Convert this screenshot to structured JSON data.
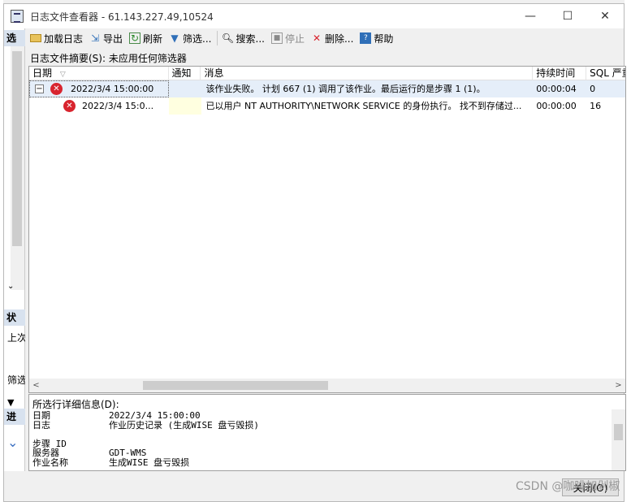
{
  "window": {
    "title": "日志文件查看器 - 61.143.227.49,10524",
    "min_glyph": "—",
    "max_glyph": "☐",
    "close_glyph": "✕"
  },
  "left_pane": {
    "head1": "选",
    "head2": "状",
    "text1": "上次",
    "text2": "筛选",
    "head3": "进"
  },
  "toolbar": {
    "load_log": "加载日志",
    "export": "导出",
    "refresh": "刷新",
    "filter": "筛选...",
    "search": "搜索...",
    "stop": "停止",
    "delete": "删除...",
    "help": "帮助"
  },
  "summary": "日志文件摘要(S): 未应用任何筛选器",
  "grid": {
    "columns": [
      "日期",
      "通知",
      "消息",
      "持续时间",
      "SQL 严重"
    ],
    "rows": [
      {
        "date": "2022/3/4 15:00:00",
        "notify": "",
        "message": "该作业失败。  计划 667 (1) 调用了该作业。最后运行的是步骤 1 (1)。",
        "duration": "00:00:04",
        "severity": "0"
      },
      {
        "date": "2022/3/4 15:0...",
        "notify": "",
        "message": "已以用户 NT AUTHORITY\\NETWORK SERVICE 的身份执行。 找不到存储过...",
        "duration": "00:00:00",
        "severity": "16"
      }
    ]
  },
  "details": {
    "label": "所选行详细信息(D):",
    "lines": [
      {
        "k": "日期",
        "v": "2022/3/4 15:00:00"
      },
      {
        "k": "日志",
        "v": "作业历史记录 (生成WISE 盘亏毁损)"
      },
      {
        "k": "",
        "v": ""
      },
      {
        "k": "步骤 ID",
        "v": ""
      },
      {
        "k": "服务器",
        "v": "GDT-WMS"
      },
      {
        "k": "作业名称",
        "v": "    生成WISE 盘亏毁损"
      }
    ]
  },
  "close_label": "关闭(O)",
  "watermark": "CSDN @咖啡加剁椒"
}
